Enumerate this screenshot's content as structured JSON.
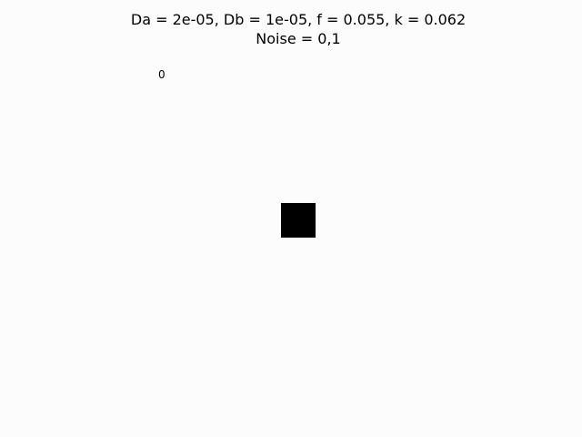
{
  "title": {
    "line1": "Da = 2e-05, Db = 1e-05, f = 0.055, k = 0.062",
    "line2": "Noise = 0,1"
  },
  "frame_counter": "0",
  "colors": {
    "background": "#fcfcfc",
    "square": "#000000",
    "text": "#000000"
  }
}
